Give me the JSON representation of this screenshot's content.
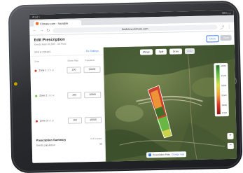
{
  "status_bar": {
    "left": "iPad ≈",
    "right": "98% ▭"
  },
  "browser": {
    "tab_title": "Climate.com - Variable",
    "url": "fieldview.climate.com"
  },
  "app": {
    "title": "Edit Prescription",
    "subtitle": "Seeds Rate 90,000 · 40 Plots",
    "close_label": "Close",
    "save_label": "Save"
  },
  "panel": {
    "header_label": "VRS & ZONES",
    "settings_link": "Rx Settings",
    "columns": {
      "zone": "Zone",
      "rate": "Seeds Rate",
      "amount": "Population"
    },
    "zones": [
      {
        "name": "Zone 1",
        "sub": "12.4 ac",
        "rate": "100",
        "amount": "30000",
        "color": "#d93a2b"
      },
      {
        "name": "Zone 2",
        "sub": "14.0 ac",
        "rate": "200",
        "amount": "30000",
        "color": "#6abf45"
      },
      {
        "name": "Zone 3",
        "sub": "9.6 ac",
        "rate": "100",
        "amount": "40000",
        "color": "#d93a2b"
      }
    ],
    "summary": {
      "title": "Prescription Summary",
      "meta": "2 of 3 zones",
      "label": "Seeds population",
      "value": "35"
    }
  },
  "map": {
    "tools": [
      "Merge",
      "Split",
      "Draw",
      "Undo"
    ],
    "legend": [
      "40000",
      "37500",
      "35000",
      "32500",
      "30000",
      "27500"
    ],
    "legend_colors": [
      "#1f7a2b",
      "#6abf45",
      "#d9e04a",
      "#f2a33a",
      "#d93a2b",
      "#8a1a12"
    ],
    "footer_label": "Prescription Plots",
    "footer_link": "Change map",
    "zoom_in": "+",
    "zoom_out": "−"
  }
}
